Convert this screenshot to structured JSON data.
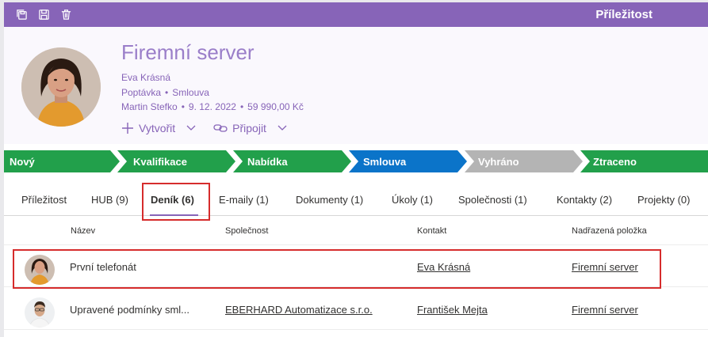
{
  "title": "Příležitost",
  "toolbar": {
    "icons": [
      "save-all-icon",
      "save-icon",
      "delete-icon"
    ]
  },
  "record": {
    "name": "Firemní server",
    "contact": "Eva Krásná",
    "type": "Poptávka",
    "stage": "Smlouva",
    "owner": "Martin Stefko",
    "date": "9. 12. 2022",
    "amount": "59 990,00 Kč",
    "separator": "•"
  },
  "actions": {
    "create": "Vytvořit",
    "connect": "Připojit"
  },
  "stages": [
    {
      "label": "Nový",
      "color": "#22a04b"
    },
    {
      "label": "Kvalifikace",
      "color": "#22a04b"
    },
    {
      "label": "Nabídka",
      "color": "#22a04b"
    },
    {
      "label": "Smlouva",
      "color": "#0b74c9"
    },
    {
      "label": "Vyhráno",
      "color": "#b4b4b4"
    },
    {
      "label": "Ztraceno",
      "color": "#22a04b"
    }
  ],
  "tabs": [
    {
      "label": "Příležitost"
    },
    {
      "label": "HUB (9)"
    },
    {
      "label": "Deník (6)",
      "active": true
    },
    {
      "label": "E-maily (1)"
    },
    {
      "label": "Dokumenty (1)"
    },
    {
      "label": "Úkoly (1)"
    },
    {
      "label": "Společnosti (1)"
    },
    {
      "label": "Kontakty (2)"
    },
    {
      "label": "Projekty (0)"
    }
  ],
  "columns": {
    "name": "Název",
    "company": "Společnost",
    "contact": "Kontakt",
    "parent": "Nadřazená položka"
  },
  "rows": [
    {
      "name": "První telefonát",
      "company": "",
      "contact": "Eva Krásná",
      "parent": "Firemní server"
    },
    {
      "name": "Upravené podmínky sml...",
      "company": "EBERHARD Automatizace s.r.o.",
      "contact": "František Mejta",
      "parent": "Firemní server"
    }
  ],
  "colors": {
    "accent": "#8764b8",
    "highlight": "#d62c2c"
  }
}
